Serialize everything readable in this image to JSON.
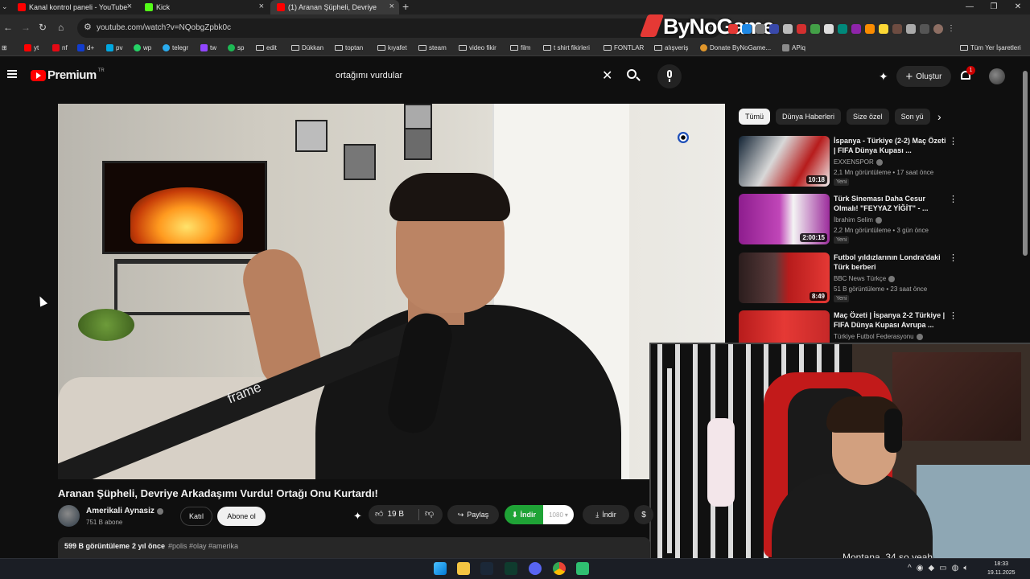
{
  "browser": {
    "tabs": [
      {
        "label": "Kanal kontrol paneli - YouTube",
        "fav_color": "#ff0000"
      },
      {
        "label": "Kick",
        "fav_color": "#53fc18"
      },
      {
        "label": "(1) Aranan Şüpheli, Devriye",
        "fav_color": "#ff0000"
      }
    ],
    "url": "youtube.com/watch?v=NQobgZpbk0c",
    "brand_overlay": "ByNoGame",
    "bookmarks": [
      {
        "label": "yt",
        "icon": "youtube-icon",
        "color": "#ff0000"
      },
      {
        "label": "nf",
        "icon": "netflix-icon",
        "color": "#e50914"
      },
      {
        "label": "d+",
        "icon": "disney-icon",
        "color": "#113ccf"
      },
      {
        "label": "pv",
        "icon": "primevideo-icon",
        "color": "#00a8e1"
      },
      {
        "label": "wp",
        "icon": "whatsapp-icon",
        "color": "#25d366"
      },
      {
        "label": "telegr",
        "icon": "telegram-icon",
        "color": "#2aabee"
      },
      {
        "label": "tw",
        "icon": "twitch-icon",
        "color": "#9146ff"
      },
      {
        "label": "sp",
        "icon": "spotify-icon",
        "color": "#1db954"
      },
      {
        "label": "edit",
        "icon": "folder-icon"
      },
      {
        "label": "Dükkan",
        "icon": "folder-icon"
      },
      {
        "label": "toptan",
        "icon": "folder-icon"
      },
      {
        "label": "kıyafet",
        "icon": "folder-icon"
      },
      {
        "label": "steam",
        "icon": "folder-icon"
      },
      {
        "label": "video fikir",
        "icon": "folder-icon"
      },
      {
        "label": "film",
        "icon": "folder-icon"
      },
      {
        "label": "t shirt fikirleri",
        "icon": "folder-icon"
      },
      {
        "label": "FONTLAR",
        "icon": "folder-icon"
      },
      {
        "label": "alışveriş",
        "icon": "folder-icon"
      },
      {
        "label": "Donate ByNoGame...",
        "icon": "bynogame-icon",
        "color": "#e0962b"
      },
      {
        "label": "APiq",
        "icon": "apiq-icon",
        "color": "#8a8a8a"
      }
    ],
    "all_bookmarks": "Tüm Yer İşaretleri"
  },
  "masthead": {
    "logo_text": "Premium",
    "logo_region": "TR",
    "search_query": "ortağımı vurdular",
    "create_label": "Oluştur",
    "notification_count": "1"
  },
  "video": {
    "title": "Aranan Şüpheli, Devriye Arkadaşımı Vurdu! Ortağı Onu Kurtardı!",
    "overlay_text": "frame",
    "channel_name": "Amerikali Aynasiz",
    "subscribers": "751 B abone",
    "join_label": "Katıl",
    "subscribe_label": "Abone ol",
    "likes": "19 B",
    "share_label": "Paylaş",
    "download_ext_label": "İndir",
    "download_quality": "1080",
    "download_label": "İndir",
    "views": "599 B görüntüleme",
    "age": "2 yıl önce",
    "tags": "#polis #olay #amerika"
  },
  "sidebar": {
    "chips": [
      "Tümü",
      "Dünya Haberleri",
      "Size özel",
      "Son yü"
    ],
    "recommendations": [
      {
        "title": "İspanya - Türkiye (2-2) Maç Özeti | FIFA Dünya Kupası ...",
        "channel": "EXXENSPOR",
        "meta": "2,1 Mn görüntüleme • 17 saat önce",
        "badge": "Yeni",
        "duration": "10:18"
      },
      {
        "title": "Türk Sineması Daha Cesur Olmalı! \"FEYYAZ YİĞİT\" - ...",
        "channel": "İbrahim Selim",
        "meta": "2,2 Mn görüntüleme • 3 gün önce",
        "badge": "Yeni",
        "duration": "2:00:15"
      },
      {
        "title": "Futbol yıldızlarının Londra'daki Türk berberi",
        "channel": "BBC News Türkçe",
        "meta": "51 B görüntüleme • 23 saat önce",
        "badge": "Yeni",
        "duration": "8:49"
      },
      {
        "title": "Maç Özeti | İspanya 2-2 Türkiye | FIFA Dünya Kupası Avrupa ...",
        "channel": "Türkiye Futbol Federasyonu",
        "meta": "",
        "badge": "",
        "duration": ""
      }
    ]
  },
  "webcam": {
    "chat_text": "Montana_34  so yeah"
  },
  "taskbar": {
    "time": "18:33",
    "date": "19.11.2025"
  }
}
